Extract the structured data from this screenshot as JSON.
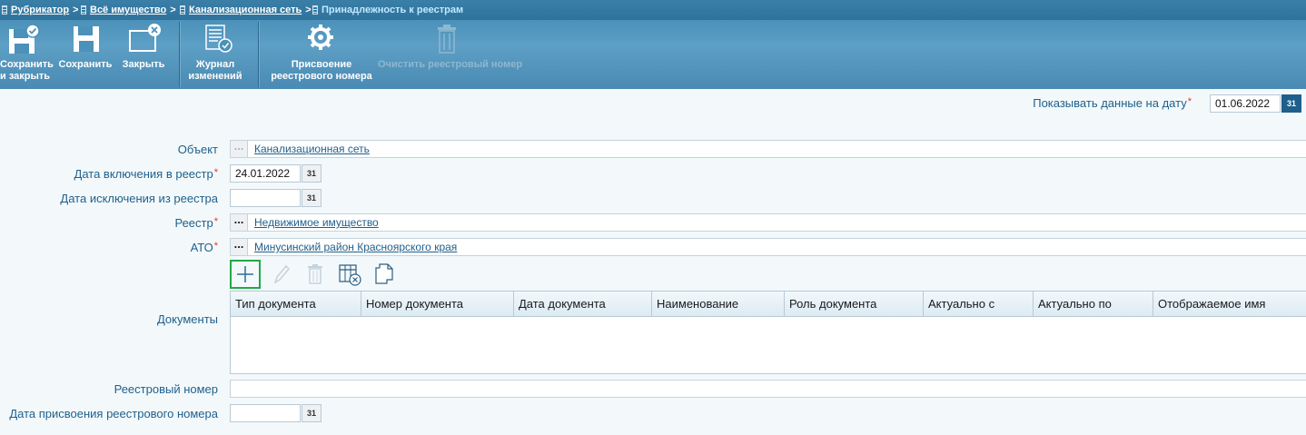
{
  "breadcrumb": {
    "items": [
      "Рубрикатор",
      "Всё имущество",
      "Канализационная сеть"
    ],
    "separator": ">",
    "current": "Принадлежность к реестрам"
  },
  "toolbar": {
    "save_close": [
      "Сохранить",
      "и закрыть"
    ],
    "save": "Сохранить",
    "close": "Закрыть",
    "journal": [
      "Журнал",
      "изменений"
    ],
    "assign": [
      "Присвоение",
      "реестрового номера"
    ],
    "clear": "Очистить реестровый номер"
  },
  "show_date": {
    "label": "Показывать данные на дату",
    "value": "01.06.2022",
    "cal": "31"
  },
  "form": {
    "object": {
      "label": "Объект",
      "value": "Канализационная сеть",
      "dots": "..."
    },
    "date_include": {
      "label": "Дата включения в реестр",
      "value": "24.01.2022",
      "cal": "31"
    },
    "date_exclude": {
      "label": "Дата исключения из реестра",
      "value": "",
      "cal": "31"
    },
    "registry": {
      "label": "Реестр",
      "value": "Недвижимое имущество",
      "dots": "..."
    },
    "ato": {
      "label": "АТО",
      "value": "Минусинский район Красноярского края",
      "dots": "..."
    },
    "documents": {
      "label": "Документы",
      "columns": [
        "Тип документа",
        "Номер документа",
        "Дата документа",
        "Наименование",
        "Роль документа",
        "Актуально с",
        "Актуально по",
        "Отображаемое имя"
      ]
    },
    "reg_number": {
      "label": "Реестровый номер",
      "value": ""
    },
    "reg_date": {
      "label": "Дата присвоения реестрового номера",
      "value": "",
      "cal": "31"
    }
  },
  "colors": {
    "header": "#4b91b9",
    "label": "#1f5f8b",
    "required": "#e0322b",
    "add_border": "#22a84a"
  }
}
